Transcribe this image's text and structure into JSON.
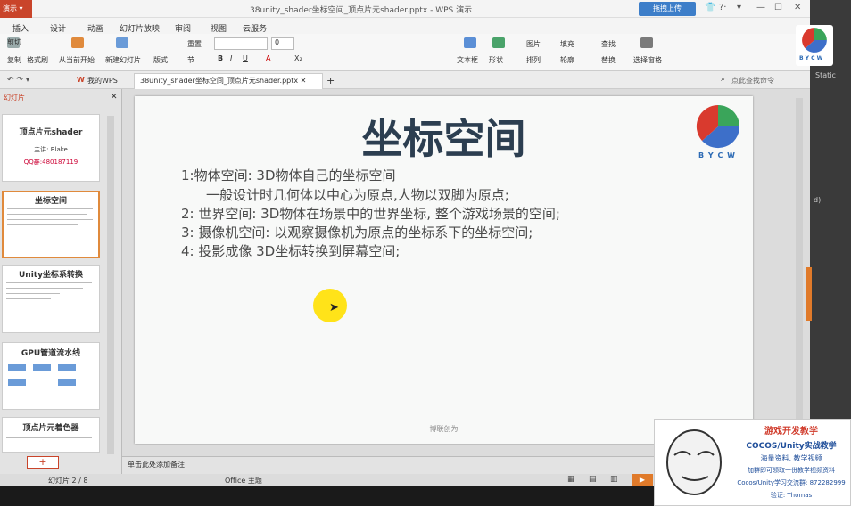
{
  "titlebar": {
    "app_label": "演示",
    "doc_title": "38unity_shader坐标空间_顶点片元shader.pptx - WPS 演示",
    "share_label": "拖拽上传"
  },
  "menu": [
    "插入",
    "设计",
    "动画",
    "幻灯片放映",
    "审阅",
    "视图",
    "云服务"
  ],
  "ribbon": {
    "cut": "剪切",
    "copy": "复制",
    "format_painter": "格式刷",
    "play_from_current": "从当前开始",
    "new_slide": "新建幻灯片",
    "layout": "版式",
    "section": "节",
    "reset": "重置",
    "font_size": "0",
    "textbox": "文本框",
    "shape": "形状",
    "arrange": "排列",
    "picture": "图片",
    "fill": "填充",
    "outline": "轮廓",
    "find": "查找",
    "replace": "替换",
    "select_pane": "选择窗格",
    "bold": "B",
    "italic": "I",
    "underline": "U",
    "font_color": "A",
    "subscript": "X₂"
  },
  "tabs": {
    "home": "我的WPS",
    "active": "38unity_shader坐标空间_顶点片元shader.pptx",
    "search_placeholder": "点此查找命令"
  },
  "left_pane": {
    "header": "幻灯片",
    "add_label": "+",
    "thumbnails": [
      {
        "title": "顶点片元shader",
        "sub1": "主讲: Blake",
        "sub2": "QQ群:480187119"
      },
      {
        "title": "坐标空间"
      },
      {
        "title": "Unity坐标系转换"
      },
      {
        "title": "GPU管道流水线"
      },
      {
        "title": "顶点片元着色器"
      }
    ]
  },
  "slide": {
    "title": "坐标空间",
    "logo_text": "B Y C W",
    "lines": [
      "1:物体空间: 3D物体自己的坐标空间",
      "一般设计时几何体以中心为原点,人物以双脚为原点;",
      "2: 世界空间: 3D物体在场景中的世界坐标, 整个游戏场景的空间;",
      "3: 摄像机空间: 以观察摄像机为原点的坐标系下的坐标空间;",
      "4: 投影成像  3D坐标转换到屏幕空间;"
    ],
    "footer": "博联创为"
  },
  "notes_placeholder": "单击此处添加备注",
  "status": {
    "slide_count": "幻灯片 2 / 8",
    "theme": "Office 主题"
  },
  "right_pane": {
    "logo_text": "B Y C W",
    "static_label": "Static",
    "label_d": "d)"
  },
  "promo": {
    "title": "游戏开发教学",
    "subtitle": "COCOS/Unity实战教学",
    "line1": "海量资料, 教学视频",
    "line2": "加群即可领取一份教学视频资料",
    "line3": "Cocos/Unity学习交流群: 872282999",
    "line4": "验证: Thomas"
  },
  "colors": {
    "accent": "#c9442a",
    "share": "#3d7ec9",
    "slide_title": "#2c3e50",
    "promo_title": "#d03a2a",
    "promo_sub": "#1f4e9a",
    "cursor_highlight": "#ffe000"
  }
}
